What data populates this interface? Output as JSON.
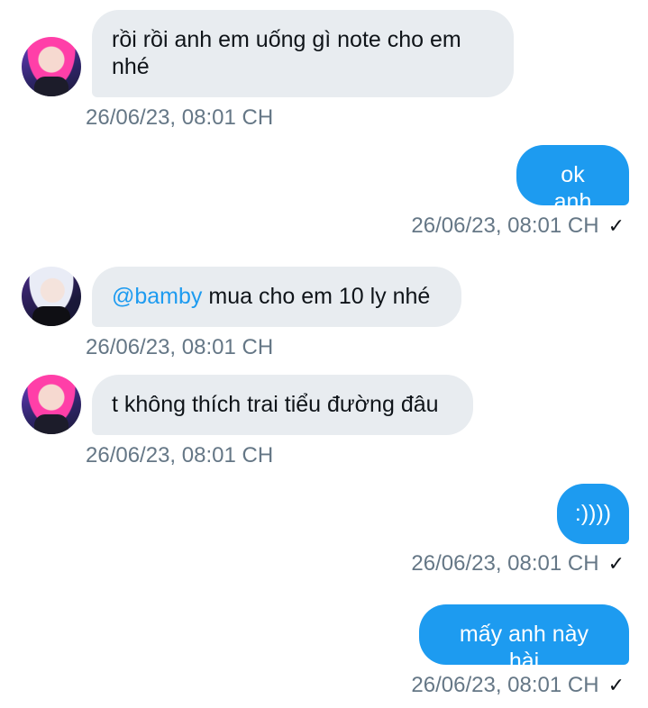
{
  "messages": [
    {
      "id": "m1",
      "direction": "incoming",
      "avatar": "pink-hair-avatar",
      "text": "rồi rồi anh em uống gì note cho em nhé",
      "time": "26/06/23, 08:01 CH"
    },
    {
      "id": "m2",
      "direction": "outgoing",
      "text": "ok anh",
      "time": "26/06/23, 08:01 CH",
      "status": "✓"
    },
    {
      "id": "m3",
      "direction": "incoming",
      "avatar": "silver-hair-avatar",
      "mention": "@bamby",
      "text": " mua cho em 10 ly nhé",
      "time": "26/06/23, 08:01 CH"
    },
    {
      "id": "m4",
      "direction": "incoming",
      "avatar": "pink-hair-avatar",
      "text": "t không thích trai tiểu đường đâu",
      "time": "26/06/23, 08:01 CH"
    },
    {
      "id": "m5",
      "direction": "outgoing",
      "text": ":))))",
      "time": "26/06/23, 08:01 CH",
      "status": "✓"
    },
    {
      "id": "m6",
      "direction": "outgoing",
      "text": "mấy anh này hài",
      "time": "26/06/23, 08:01 CH",
      "status": "✓"
    }
  ],
  "colors": {
    "incoming_bubble": "#e8ecf0",
    "outgoing_bubble": "#1d9bf0",
    "mention": "#1d9bf0",
    "timestamp": "#657786"
  }
}
